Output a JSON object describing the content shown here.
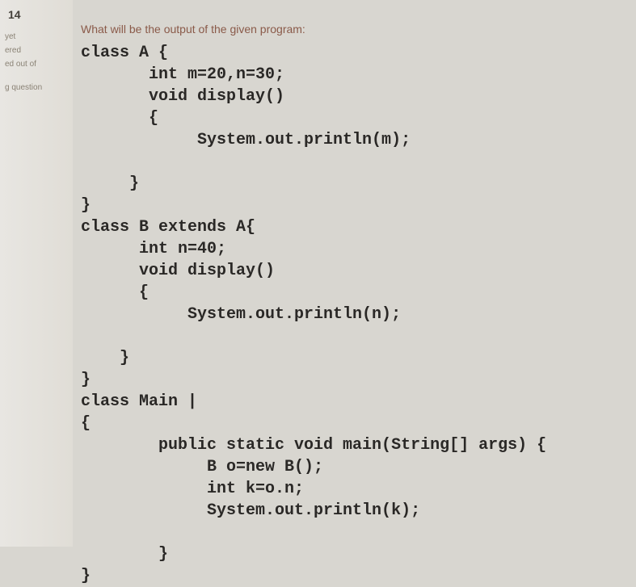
{
  "sidebar": {
    "question_number": "14",
    "line1": "yet",
    "line2": "ered",
    "line3": "ed out of",
    "line4": "g question"
  },
  "question_prompt": "What will be the output of the given program:",
  "code": "class A {\n       int m=20,n=30;\n       void display()\n       {\n            System.out.println(m);\n\n     }\n}\nclass B extends A{\n      int n=40;\n      void display()\n      {\n           System.out.println(n);\n\n    }\n}\nclass Main |\n{\n        public static void main(String[] args) {\n             B o=new B();\n             int k=o.n;\n             System.out.println(k);\n\n        }\n}"
}
